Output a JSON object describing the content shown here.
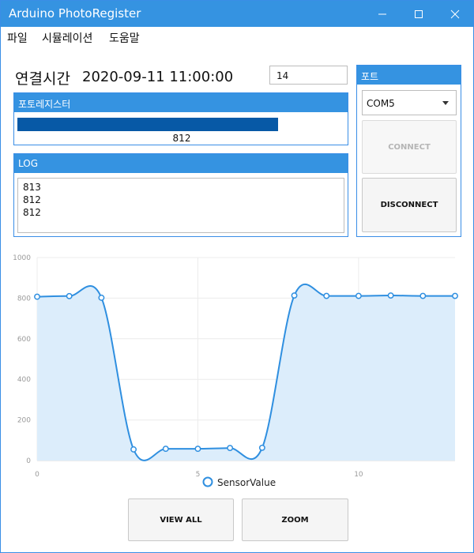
{
  "window": {
    "title": "Arduino PhotoRegister",
    "minimize_icon": "minimize-icon",
    "maximize_icon": "maximize-icon",
    "close_icon": "close-icon"
  },
  "menu": {
    "items": [
      {
        "label": "파일"
      },
      {
        "label": "시뮬레이션"
      },
      {
        "label": "도움말"
      }
    ]
  },
  "connection": {
    "label": "연결시간",
    "time": "2020-09-11 11:00:00",
    "input_value": "14"
  },
  "photoresistor": {
    "header": "포토레지스터",
    "value_text": "812",
    "progress_fraction": 0.793
  },
  "log": {
    "header": "LOG",
    "lines": [
      "813",
      "812",
      "812"
    ]
  },
  "port": {
    "header": "포트",
    "selected": "COM5",
    "connect_label": "CONNECT",
    "disconnect_label": "DISCONNECT"
  },
  "buttons": {
    "view_all": "VIEW ALL",
    "zoom": "ZOOM"
  },
  "colors": {
    "accent": "#3593e1",
    "progress": "#0759a6",
    "series_line": "#2f8fe0",
    "series_fill": "#dcedfb"
  },
  "chart_data": {
    "type": "area",
    "title": "",
    "xlabel": "",
    "ylabel": "",
    "x": [
      0,
      1,
      2,
      3,
      4,
      5,
      6,
      7,
      8,
      9,
      10,
      11,
      12,
      13
    ],
    "series": [
      {
        "name": "SensorValue",
        "values": [
          807,
          810,
          802,
          55,
          58,
          58,
          62,
          63,
          813,
          811,
          811,
          813,
          811,
          811
        ]
      }
    ],
    "xlim": [
      0,
      13
    ],
    "ylim": [
      0,
      1000
    ],
    "xticks": [
      0,
      5,
      10
    ],
    "yticks": [
      0,
      200,
      400,
      600,
      800,
      1000
    ],
    "grid": true,
    "legend": "bottom-center"
  }
}
